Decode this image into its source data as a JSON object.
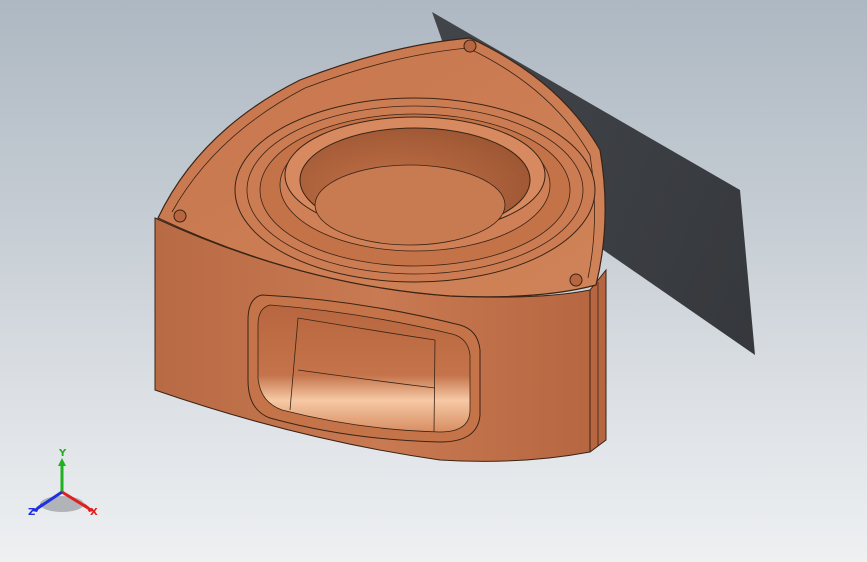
{
  "viewport": {
    "background_top": "#aeb8c2",
    "background_bottom": "#eef0f2"
  },
  "model": {
    "part_color": "#c97a52",
    "part_shadow_color": "#a0593a",
    "highlight_color": "#f4c8a6",
    "shadow_color": "#2b2d31"
  },
  "triad": {
    "x_label": "X",
    "y_label": "Y",
    "z_label": "Z",
    "x_color": "#e02020",
    "y_color": "#20b020",
    "z_color": "#2030e0"
  }
}
